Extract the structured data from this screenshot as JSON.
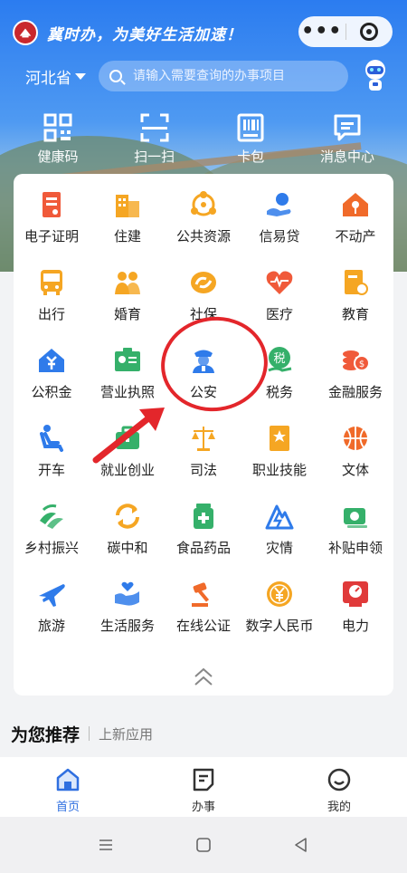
{
  "header": {
    "slogan": "冀时办，为美好生活加速！",
    "capsule_more": "•••"
  },
  "location": {
    "region": "河北省"
  },
  "search": {
    "placeholder": "请输入需要查询的办事项目"
  },
  "quick_actions": [
    {
      "label": "健康码",
      "icon": "health-code-icon"
    },
    {
      "label": "扫一扫",
      "icon": "scan-icon"
    },
    {
      "label": "卡包",
      "icon": "card-wallet-icon"
    },
    {
      "label": "消息中心",
      "icon": "message-center-icon"
    }
  ],
  "services": [
    {
      "label": "电子证明",
      "icon": "certificate-icon",
      "color": "#f05a3a"
    },
    {
      "label": "住建",
      "icon": "building-icon",
      "color": "#f5a623"
    },
    {
      "label": "公共资源",
      "icon": "network-icon",
      "color": "#f5a623"
    },
    {
      "label": "信易贷",
      "icon": "loan-hand-icon",
      "color": "#2f7bea"
    },
    {
      "label": "不动产",
      "icon": "house-key-icon",
      "color": "#f06a2a"
    },
    {
      "label": "出行",
      "icon": "bus-icon",
      "color": "#f5a623"
    },
    {
      "label": "婚育",
      "icon": "couple-icon",
      "color": "#f5a623"
    },
    {
      "label": "社保",
      "icon": "social-security-icon",
      "color": "#f5a623"
    },
    {
      "label": "医疗",
      "icon": "heart-pulse-icon",
      "color": "#f05a3a"
    },
    {
      "label": "教育",
      "icon": "education-book-icon",
      "color": "#f5a623"
    },
    {
      "label": "公积金",
      "icon": "housing-fund-icon",
      "color": "#2f7bea"
    },
    {
      "label": "营业执照",
      "icon": "business-license-icon",
      "color": "#35b06a"
    },
    {
      "label": "公安",
      "icon": "police-icon",
      "color": "#2f7bea"
    },
    {
      "label": "税务",
      "icon": "tax-icon",
      "color": "#35b06a"
    },
    {
      "label": "金融服务",
      "icon": "coins-icon",
      "color": "#f05a3a"
    },
    {
      "label": "开车",
      "icon": "driver-seat-icon",
      "color": "#2f7bea"
    },
    {
      "label": "就业创业",
      "icon": "briefcase-icon",
      "color": "#35b06a"
    },
    {
      "label": "司法",
      "icon": "scales-icon",
      "color": "#f5a623"
    },
    {
      "label": "职业技能",
      "icon": "skill-certificate-icon",
      "color": "#f5a623"
    },
    {
      "label": "文体",
      "icon": "basketball-icon",
      "color": "#f06a2a"
    },
    {
      "label": "乡村振兴",
      "icon": "rural-revitalization-icon",
      "color": "#35b06a"
    },
    {
      "label": "碳中和",
      "icon": "recycle-icon",
      "color": "#f5a623"
    },
    {
      "label": "食品药品",
      "icon": "medicine-bottle-icon",
      "color": "#35b06a"
    },
    {
      "label": "灾情",
      "icon": "disaster-icon",
      "color": "#2f7bea"
    },
    {
      "label": "补贴申领",
      "icon": "subsidy-money-icon",
      "color": "#35b06a"
    },
    {
      "label": "旅游",
      "icon": "airplane-icon",
      "color": "#2f7bea"
    },
    {
      "label": "生活服务",
      "icon": "life-service-icon",
      "color": "#2f7bea"
    },
    {
      "label": "在线公证",
      "icon": "gavel-icon",
      "color": "#f06a2a"
    },
    {
      "label": "数字人民币",
      "icon": "digital-yuan-icon",
      "color": "#f5a623"
    },
    {
      "label": "电力",
      "icon": "power-meter-icon",
      "color": "#e03a3a"
    }
  ],
  "recommend": {
    "title": "为您推荐",
    "subtitle": "上新应用"
  },
  "tabbar": [
    {
      "label": "首页",
      "icon": "home-icon",
      "active": true
    },
    {
      "label": "办事",
      "icon": "service-doc-icon",
      "active": false
    },
    {
      "label": "我的",
      "icon": "profile-smile-icon",
      "active": false
    }
  ]
}
